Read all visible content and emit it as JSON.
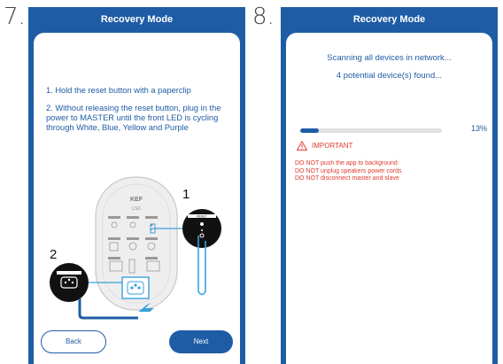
{
  "left_step": {
    "number": "7.",
    "title": "Recovery Mode",
    "instruction_1": "1. Hold the reset button with a paperclip",
    "instruction_2": "2. Without releasing the reset button, plug in the power to MASTER until the front LED is cycling through White, Blue, Yellow and Purple",
    "diagram": {
      "callout_1": "1",
      "callout_2": "2",
      "brand": "KEF",
      "model": "LSX",
      "reset_label": "RESET"
    },
    "back_label": "Back",
    "next_label": "Next"
  },
  "right_step": {
    "number": "8.",
    "title": "Recovery Mode",
    "scan_status": "Scanning all devices in network...",
    "found_status": "4 potential device(s) found...",
    "progress_percent": 13,
    "progress_label": "13%",
    "important_label": "IMPORTANT",
    "warnings": [
      "DO NOT push the app to background",
      "DO NOT unplug speakers power cords",
      "DO NOT disconnect master and slave"
    ]
  },
  "colors": {
    "brand_blue": "#1f5ca6",
    "warning_red": "#e03b2e",
    "progress_track": "#e2e2e2"
  }
}
